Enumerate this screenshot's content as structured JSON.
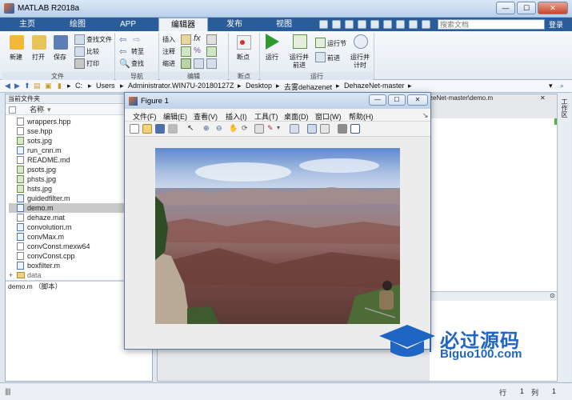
{
  "window": {
    "title": "MATLAB R2018a"
  },
  "tabs": [
    {
      "label": "主页"
    },
    {
      "label": "绘图"
    },
    {
      "label": "APP"
    },
    {
      "label": "编辑器"
    },
    {
      "label": "发布"
    },
    {
      "label": "视图"
    }
  ],
  "search": {
    "placeholder": "搜索文档"
  },
  "signin": {
    "label": "登录"
  },
  "toolstrip": {
    "new": "新建",
    "open": "打开",
    "save": "保存",
    "find_files": "查找文件",
    "compare": "比较",
    "print": "打印",
    "goto": "转至",
    "find": "查找",
    "insert": "插入",
    "comment": "注释",
    "indent": "缩进",
    "breakpoints": "断点",
    "run": "运行",
    "run_advance_1": "运行并",
    "run_advance_2": "前进",
    "run_section": "运行节",
    "advance": "前进",
    "run_time_1": "运行并",
    "run_time_2": "计时",
    "group_file": "文件",
    "group_nav": "导航",
    "group_edit": "编辑",
    "group_bp": "断点",
    "group_run": "运行"
  },
  "address": {
    "crumbs": [
      "C:",
      "Users",
      "Administrator.WIN7U-20180127Z",
      "Desktop",
      "去雾dehazenet",
      "DehazeNet-master"
    ]
  },
  "filepane": {
    "header": "当前文件夹",
    "col_name": "名称",
    "files": [
      {
        "name": "wrappers.hpp",
        "kind": "doc"
      },
      {
        "name": "sse.hpp",
        "kind": "doc"
      },
      {
        "name": "sots.jpg",
        "kind": "img"
      },
      {
        "name": "run_cnn.m",
        "kind": "m"
      },
      {
        "name": "README.md",
        "kind": "doc"
      },
      {
        "name": "psots.jpg",
        "kind": "img"
      },
      {
        "name": "phsts.jpg",
        "kind": "img"
      },
      {
        "name": "hsts.jpg",
        "kind": "img"
      },
      {
        "name": "guidedfilter.m",
        "kind": "m"
      },
      {
        "name": "demo.m",
        "kind": "m"
      },
      {
        "name": "dehaze.mat",
        "kind": "doc"
      },
      {
        "name": "convolution.m",
        "kind": "m"
      },
      {
        "name": "convMax.m",
        "kind": "m"
      },
      {
        "name": "convConst.mexw64",
        "kind": "doc"
      },
      {
        "name": "convConst.cpp",
        "kind": "doc"
      },
      {
        "name": "boxfilter.m",
        "kind": "m"
      },
      {
        "name": "data",
        "kind": "folder"
      }
    ],
    "selected": "demo.m",
    "detail": "demo.m （脚本）"
  },
  "editor": {
    "tab_label": "zeNet-master\\demo.m"
  },
  "workspace": {
    "label": "工作区"
  },
  "status": {
    "row_label": "行",
    "row": "1",
    "col_label": "列",
    "col": "1"
  },
  "figure": {
    "title": "Figure 1",
    "menu": [
      "文件(F)",
      "编辑(E)",
      "查看(V)",
      "插入(I)",
      "工具(T)",
      "桌面(D)",
      "窗口(W)",
      "帮助(H)"
    ]
  },
  "watermark": {
    "text": "必过源码",
    "url": "Biguo100.com"
  }
}
